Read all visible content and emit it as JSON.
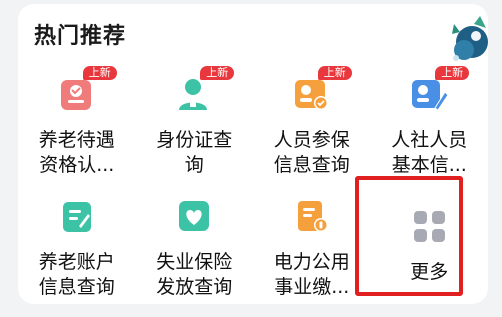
{
  "section": {
    "title": "热门推荐"
  },
  "badge_text": "上新",
  "colors": {
    "accent_red": "#e8383d",
    "highlight_red": "#e02020",
    "icon_gray": "#a7aab2"
  },
  "items": [
    {
      "line1": "养老待遇",
      "line2": "资格认...",
      "icon": "elderly-certification-icon",
      "badge": "上新"
    },
    {
      "line1": "身份证查",
      "line2": "询",
      "icon": "id-card-user-icon",
      "badge": "上新"
    },
    {
      "line1": "人员参保",
      "line2": "信息查询",
      "icon": "insurance-person-check-icon",
      "badge": "上新"
    },
    {
      "line1": "人社人员",
      "line2": "基本信...",
      "icon": "person-edit-icon",
      "badge": "上新"
    },
    {
      "line1": "养老账户",
      "line2": "信息查询",
      "icon": "pension-account-icon"
    },
    {
      "line1": "失业保险",
      "line2": "发放查询",
      "icon": "unemployment-heart-icon"
    },
    {
      "line1": "电力公用",
      "line2": "事业缴...",
      "icon": "utility-bill-icon"
    },
    {
      "line1": "更多",
      "line2": "",
      "icon": "more-grid-icon"
    }
  ]
}
